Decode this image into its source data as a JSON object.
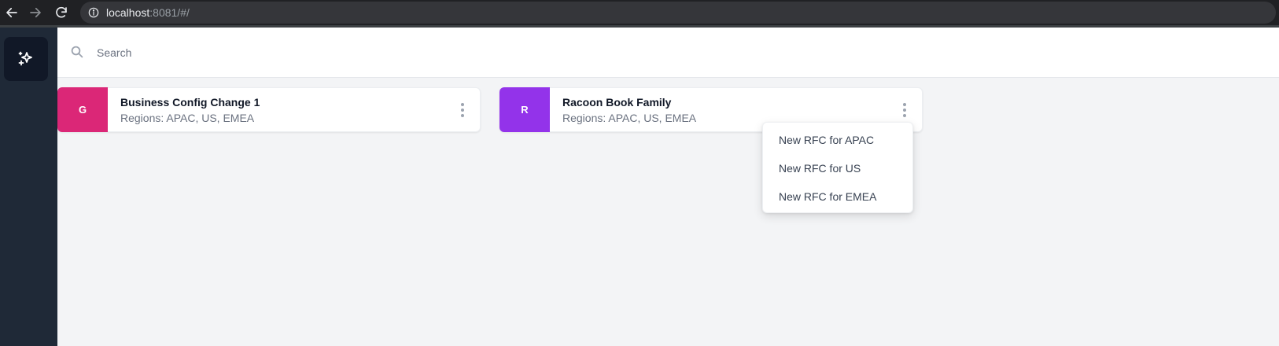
{
  "browser": {
    "url_host": "localhost",
    "url_rest": ":8081/#/"
  },
  "icons": {
    "back": "arrow-left-icon",
    "forward": "arrow-right-icon",
    "reload": "reload-icon",
    "info": "info-icon",
    "logo": "sparkles-icon",
    "search": "search-icon",
    "menu": "kebab-menu-icon"
  },
  "search": {
    "placeholder": "Search",
    "value": ""
  },
  "cards": [
    {
      "initial": "G",
      "title": "Business Config Change 1",
      "subtitle": "Regions: APAC, US, EMEA",
      "color": "#db2777"
    },
    {
      "initial": "R",
      "title": "Racoon Book Family",
      "subtitle": "Regions: APAC, US, EMEA",
      "color": "#9333ea"
    }
  ],
  "dropdown": {
    "items": [
      "New RFC for APAC",
      "New RFC for US",
      "New RFC for EMEA"
    ]
  },
  "colors": {
    "sidebar": "#1f2937",
    "logo_tile": "#111827",
    "background": "#f3f4f6"
  }
}
